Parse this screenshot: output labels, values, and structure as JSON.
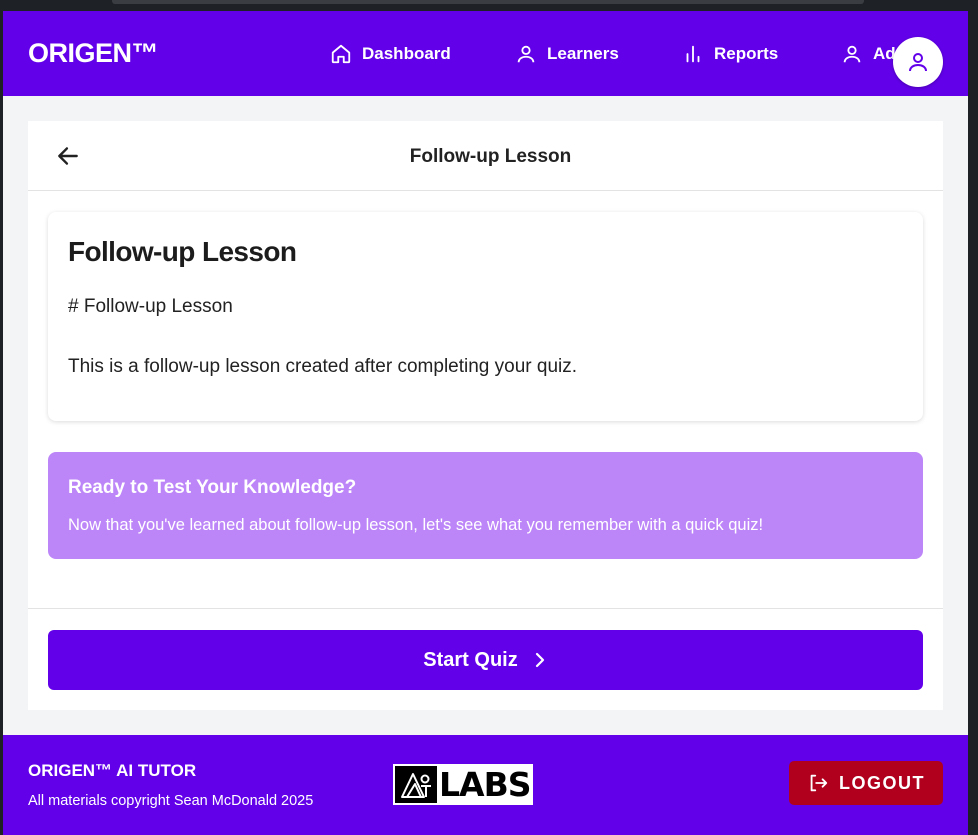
{
  "app": {
    "brand": "ORIGEN™"
  },
  "nav": {
    "items": [
      {
        "label": "Dashboard",
        "icon": "home-icon"
      },
      {
        "label": "Learners",
        "icon": "user-icon"
      },
      {
        "label": "Reports",
        "icon": "bar-chart-icon"
      },
      {
        "label": "Ad",
        "icon": "user-icon"
      }
    ],
    "avatar_icon": "user-icon"
  },
  "header": {
    "title": "Follow-up Lesson"
  },
  "lesson": {
    "title": "Follow-up Lesson",
    "lines": [
      "# Follow-up Lesson",
      "This is a follow-up lesson created after completing your quiz."
    ]
  },
  "callout": {
    "title": "Ready to Test Your Knowledge?",
    "text": "Now that you've learned about follow-up lesson, let's see what you remember with a quick quiz!"
  },
  "actions": {
    "start_quiz": "Start Quiz"
  },
  "footer": {
    "title": "ORIGEN™ AI TUTOR",
    "copyright": "All materials copyright Sean McDonald 2025",
    "logo_text": "LABS",
    "logout": "LOGOUT"
  },
  "colors": {
    "primary": "#6200ea",
    "callout": "#bd86f8",
    "logout": "#b0001e",
    "background": "#f3f4f6"
  }
}
